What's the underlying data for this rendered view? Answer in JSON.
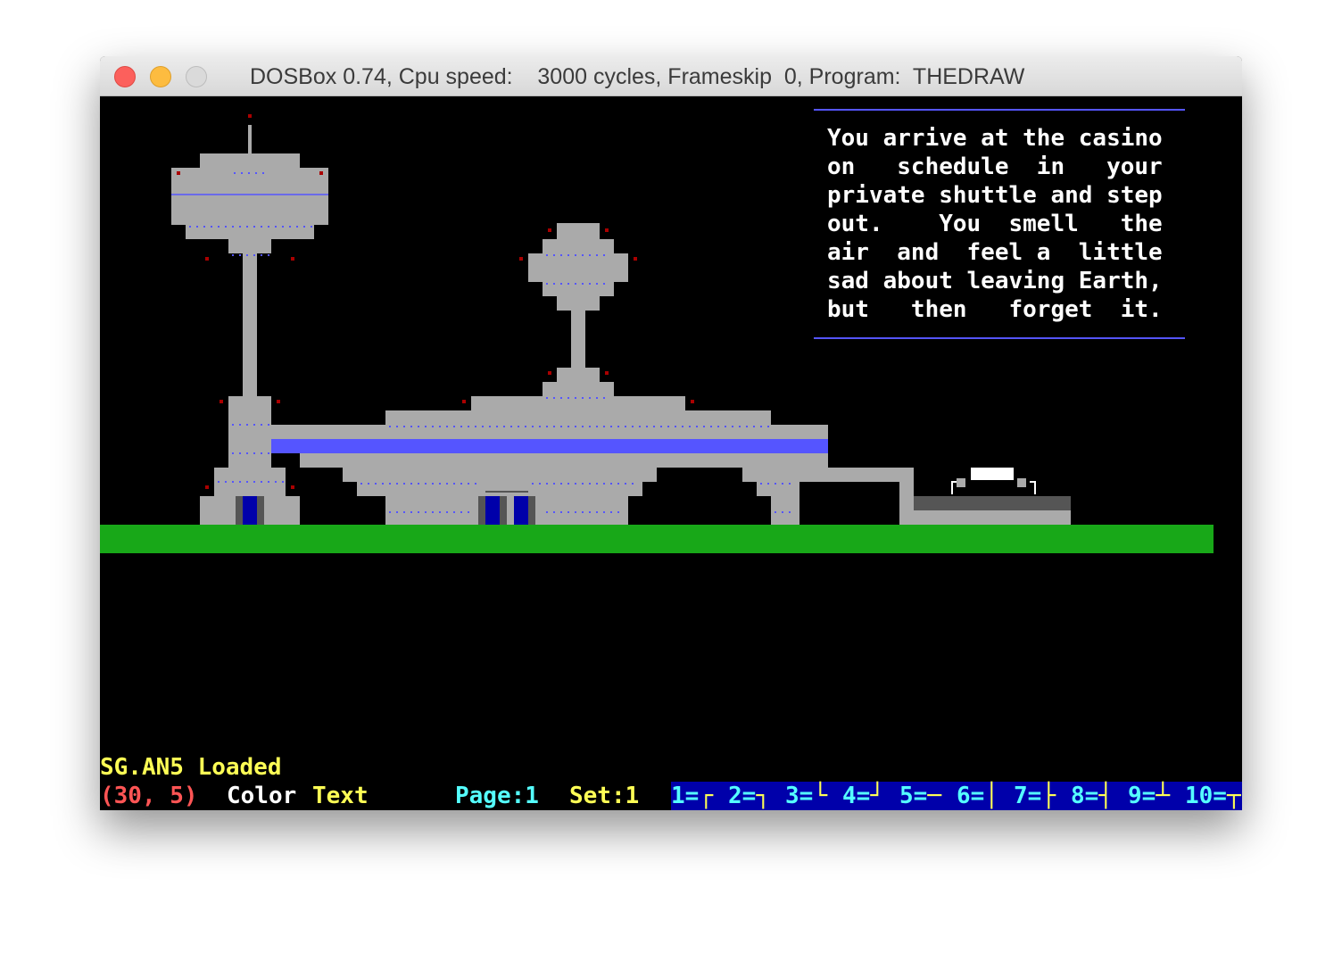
{
  "window": {
    "title": "DOSBox 0.74, Cpu speed:    3000 cycles, Frameskip  0, Program:  THEDRAW",
    "controls": [
      "close",
      "minimize",
      "zoom"
    ]
  },
  "narrative": {
    "lines": [
      "You arrive at the casino",
      "on   schedule  in   your",
      "private shuttle and step",
      "out.    You  smell   the",
      "air  and  feel a  little",
      "sad about leaving Earth,",
      "but   then   forget  it."
    ]
  },
  "status": {
    "message": "SG.AN5 Loaded",
    "coords": "(30, 5)",
    "mode_color": "Color",
    "mode_text": "Text",
    "page": "Page:1",
    "set": "Set:1",
    "function_keys": [
      {
        "label": "1=",
        "glyph": "┌"
      },
      {
        "label": "2=",
        "glyph": "┐"
      },
      {
        "label": "3=",
        "glyph": "└"
      },
      {
        "label": "4=",
        "glyph": "┘"
      },
      {
        "label": "5=",
        "glyph": "─"
      },
      {
        "label": "6=",
        "glyph": "│"
      },
      {
        "label": "7=",
        "glyph": "├"
      },
      {
        "label": "8=",
        "glyph": "┤"
      },
      {
        "label": "9=",
        "glyph": "┴"
      },
      {
        "label": "10=",
        "glyph": "┬"
      }
    ]
  },
  "colors": {
    "background": "#000000",
    "building": "#aaaaaa",
    "ground": "#18a818",
    "stripe": "#5555ff",
    "door": "#0000aa",
    "lights": "#aa0000",
    "fkey_bar": "#0000aa"
  }
}
